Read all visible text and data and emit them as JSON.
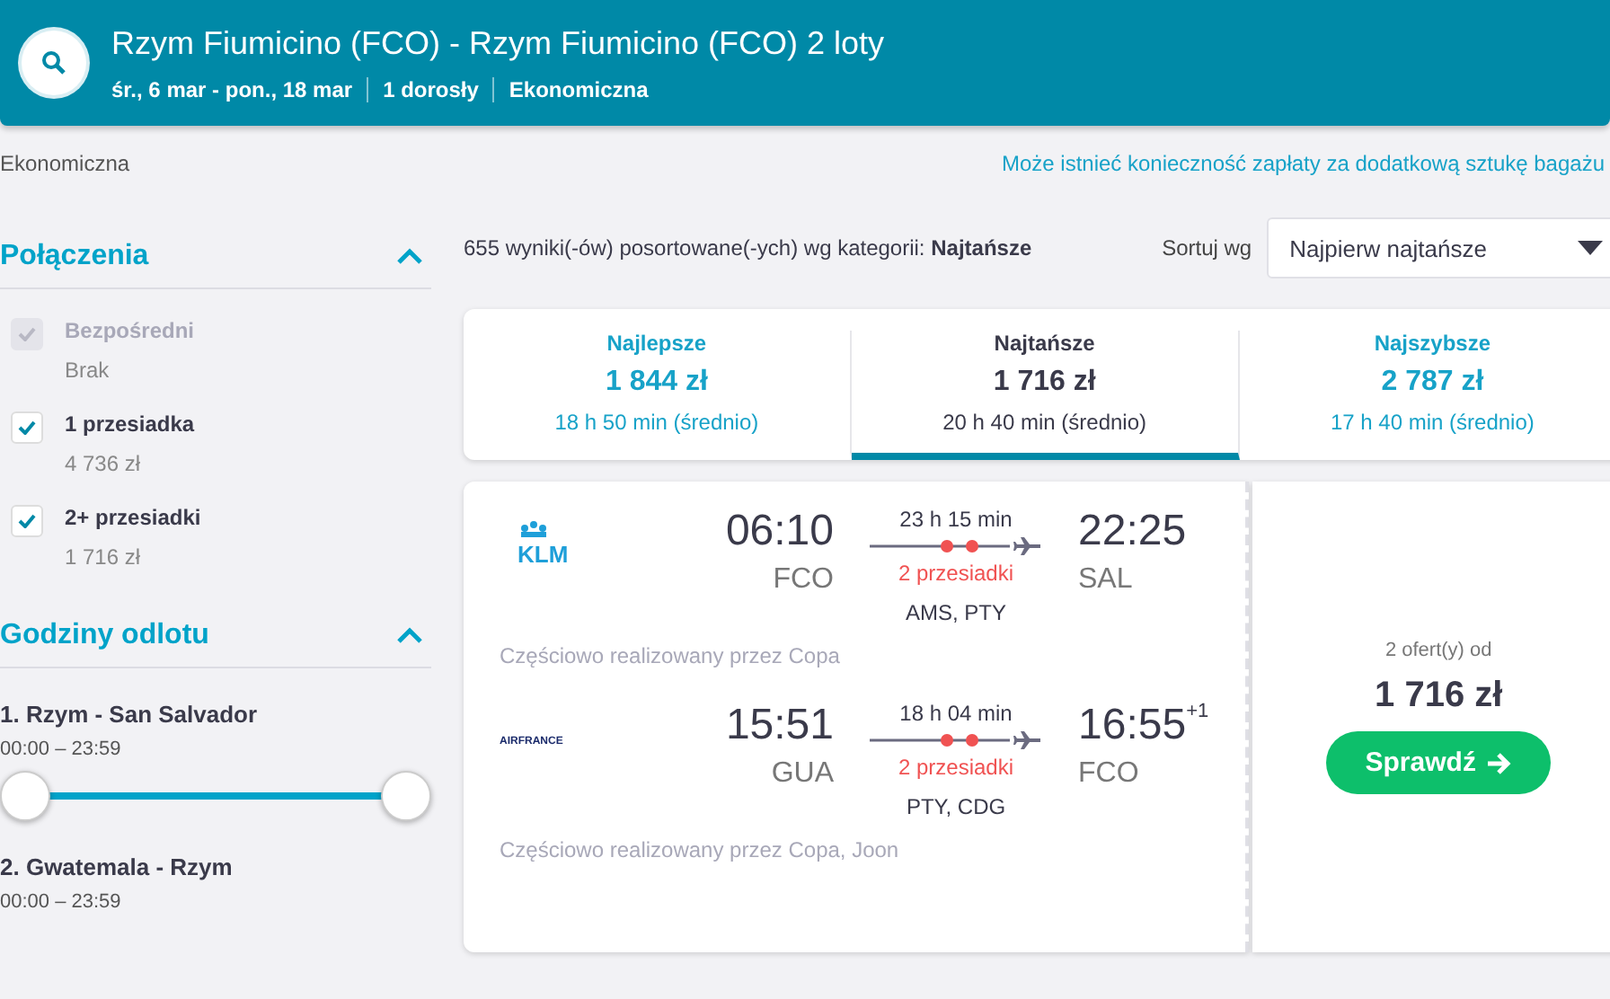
{
  "header": {
    "title": "Rzym Fiumicino (FCO) - Rzym Fiumicino (FCO) 2 loty",
    "details": [
      "śr., 6 mar - pon., 18 mar",
      "1 dorosły",
      "Ekonomiczna"
    ]
  },
  "info_bar": {
    "cabin": "Ekonomiczna",
    "baggage_link": "Może istnieć konieczność zapłaty za dodatkową sztukę bagażu"
  },
  "filters": {
    "connections": {
      "title": "Połączenia",
      "expanded": true,
      "options": [
        {
          "label": "Bezpośredni",
          "sub": "Brak",
          "checked": true,
          "disabled": true
        },
        {
          "label": "1 przesiadka",
          "sub": "4 736 zł",
          "checked": true,
          "disabled": false
        },
        {
          "label": "2+ przesiadki",
          "sub": "1 716 zł",
          "checked": true,
          "disabled": false
        }
      ]
    },
    "departure_times": {
      "title": "Godziny odlotu",
      "expanded": true,
      "ranges": [
        {
          "label": "1. Rzym - San Salvador",
          "range": "00:00 – 23:59",
          "slider_shown": true
        },
        {
          "label": "2. Gwatemala - Rzym",
          "range": "00:00 – 23:59",
          "slider_shown": false
        }
      ]
    }
  },
  "results": {
    "summary": "655 wyniki(-ów) posortowane(-ych) wg kategorii: **Najtańsze**",
    "sort_label": "Sortuj wg",
    "sort_value": "Najpierw najtańsze"
  },
  "tabs": [
    {
      "label": "Najlepsze",
      "price": "1 844 zł",
      "duration": "18 h 50 min (średnio)",
      "selected": false
    },
    {
      "label": "Najtańsze",
      "price": "1 716 zł",
      "duration": "20 h 40 min (średnio)",
      "selected": true
    },
    {
      "label": "Najszybsze",
      "price": "2 787 zł",
      "duration": "17 h 40 min (średnio)",
      "selected": false
    }
  ],
  "offer": {
    "legs": [
      {
        "airline": "KLM",
        "kind": "klm",
        "depart": "06:10",
        "from": "FCO",
        "duration": "23 h 15 min",
        "stops": "2 przesiadki",
        "via": "AMS, PTY",
        "arrive": "22:25",
        "to": "SAL",
        "note": "Częściowo realizowany przez Copa"
      },
      {
        "airline": "AIRFRANCE",
        "kind": "airfrance",
        "depart": "15:51",
        "from": "GUA",
        "duration": "18 h 04 min",
        "stops": "2 przesiadki",
        "via": "PTY, CDG",
        "arrive": "16:55",
        "plus_days": "+1",
        "to": "FCO",
        "note": "Częściowo realizowany przez Copa, Joon"
      }
    ],
    "offers_count": "2 ofert(y) od",
    "price": "1 716 zł",
    "button": "Sprawdź"
  }
}
